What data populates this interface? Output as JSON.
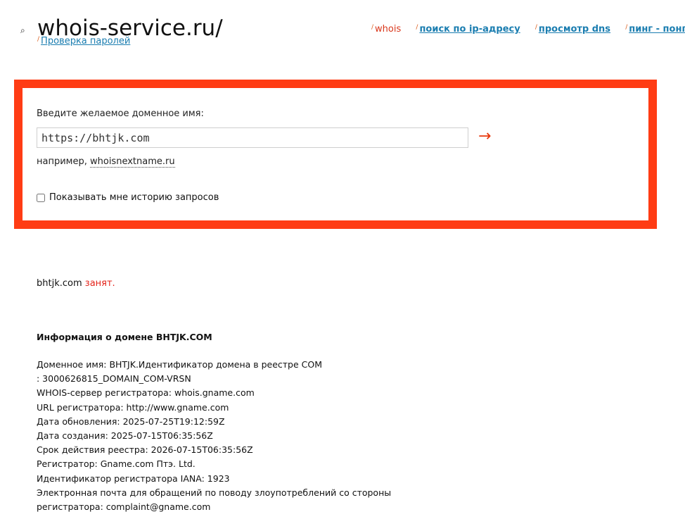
{
  "header": {
    "logo_text": "whois-service.ru/",
    "sublink_label": "Проверка паролей",
    "nav": [
      {
        "label": "whois",
        "current": true
      },
      {
        "label": "поиск по ip-адресу",
        "current": false
      },
      {
        "label": "просмотр dns",
        "current": false
      },
      {
        "label": "пинг - понг",
        "current": false
      }
    ]
  },
  "form": {
    "label": "Введите желаемое доменное имя:",
    "input_value": "https://bhtjk.com",
    "submit_symbol": "→",
    "example_prefix": "например, ",
    "example_link": "whoisnextname.ru",
    "history_label": "Показывать мне историю запросов"
  },
  "result": {
    "domain": "bhtjk.com",
    "status": "занят.",
    "info_title": "Информация о домене BHTJK.COM",
    "lines": [
      "Доменное имя: BHTJK.Идентификатор домена в реестре COM",
      ": 3000626815_DOMAIN_COM-VRSN",
      "WHOIS-сервер регистратора: whois.gname.com",
      "URL регистратора: http://www.gname.com",
      "Дата обновления: 2025-07-25T19:12:59Z",
      "Дата создания: 2025-07-15T06:35:56Z",
      "Срок действия реестра: 2026-07-15T06:35:56Z",
      "Регистратор: Gname.com Птэ. Ltd.",
      "Идентификатор регистратора IANA: 1923",
      "Электронная почта для обращений по поводу злоупотреблений со стороны",
      "регистратора: complaint@gname.com"
    ]
  },
  "colors": {
    "accent_border": "#ff3c14",
    "link": "#1a7db0",
    "status_busy": "#e4231a"
  }
}
